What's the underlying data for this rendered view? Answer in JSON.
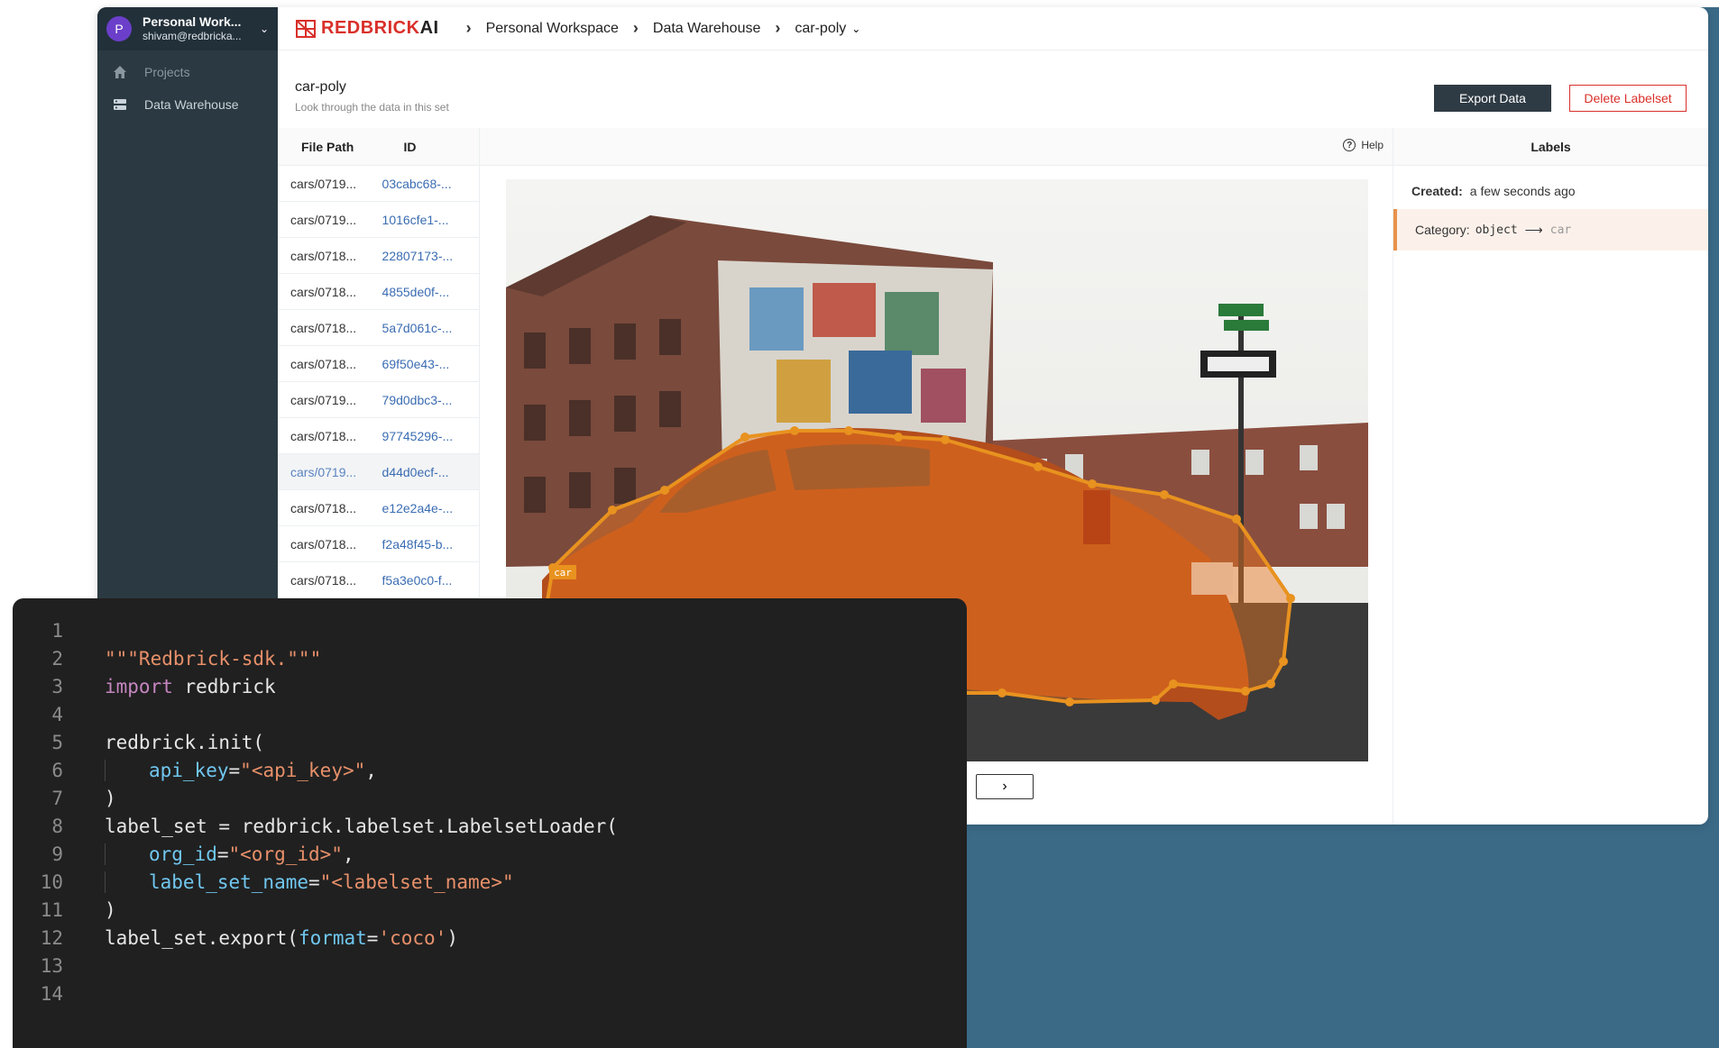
{
  "sidebar": {
    "workspace_initial": "P",
    "workspace_name": "Personal Work...",
    "workspace_email": "shivam@redbricka...",
    "items": [
      {
        "label": "Projects"
      },
      {
        "label": "Data Warehouse"
      }
    ]
  },
  "header": {
    "logo_red": "REDBRICK",
    "logo_dark": "AI",
    "breadcrumb": [
      "Personal Workspace",
      "Data Warehouse",
      "car-poly"
    ]
  },
  "page": {
    "title": "car-poly",
    "subtitle": "Look through the data in this set",
    "export_label": "Export Data",
    "delete_label": "Delete Labelset"
  },
  "table": {
    "columns": [
      "File Path",
      "ID"
    ],
    "rows": [
      {
        "path": "cars/0719...",
        "id": "03cabc68-..."
      },
      {
        "path": "cars/0719...",
        "id": "1016cfe1-..."
      },
      {
        "path": "cars/0718...",
        "id": "22807173-..."
      },
      {
        "path": "cars/0718...",
        "id": "4855de0f-..."
      },
      {
        "path": "cars/0718...",
        "id": "5a7d061c-..."
      },
      {
        "path": "cars/0718...",
        "id": "69f50e43-..."
      },
      {
        "path": "cars/0719...",
        "id": "79d0dbc3-..."
      },
      {
        "path": "cars/0718...",
        "id": "97745296-..."
      },
      {
        "path": "cars/0719...",
        "id": "d44d0ecf-..."
      },
      {
        "path": "cars/0718...",
        "id": "e12e2a4e-..."
      },
      {
        "path": "cars/0718...",
        "id": "f2a48f45-b..."
      },
      {
        "path": "cars/0718...",
        "id": "f5a3e0c0-f..."
      }
    ],
    "selected_index": 8
  },
  "viewer": {
    "help_label": "Help",
    "polygon_label": "car",
    "next_icon": "chevron-right-icon"
  },
  "labels": {
    "title": "Labels",
    "created_key": "Created:",
    "created_value": "a few seconds ago",
    "category_key": "Category:",
    "category_parent": "object",
    "category_child": "car"
  },
  "code": {
    "lines": [
      "1",
      "2",
      "3",
      "4",
      "5",
      "6",
      "7",
      "8",
      "9",
      "10",
      "11",
      "12",
      "13",
      "14"
    ],
    "docstring": "\"\"\"Redbrick-sdk.\"\"\"",
    "import_kw": "import",
    "import_mod": " redbrick",
    "init_call": "redbrick.init(",
    "api_key_arg": "api_key",
    "api_key_val": "\"<api_key>\"",
    "close_paren": ")",
    "loader_call": "label_set = redbrick.labelset.LabelsetLoader(",
    "org_id_arg": "org_id",
    "org_id_val": "\"<org_id>\"",
    "name_arg": "label_set_name",
    "name_val": "\"<labelset_name>\"",
    "export_call": "label_set.export(",
    "format_arg": "format",
    "format_val": "'coco'"
  },
  "colors": {
    "accent_red": "#d9302a",
    "polygon": "#e8921f",
    "sidebar": "#2b3a42",
    "background_blue": "#3b6a87"
  }
}
